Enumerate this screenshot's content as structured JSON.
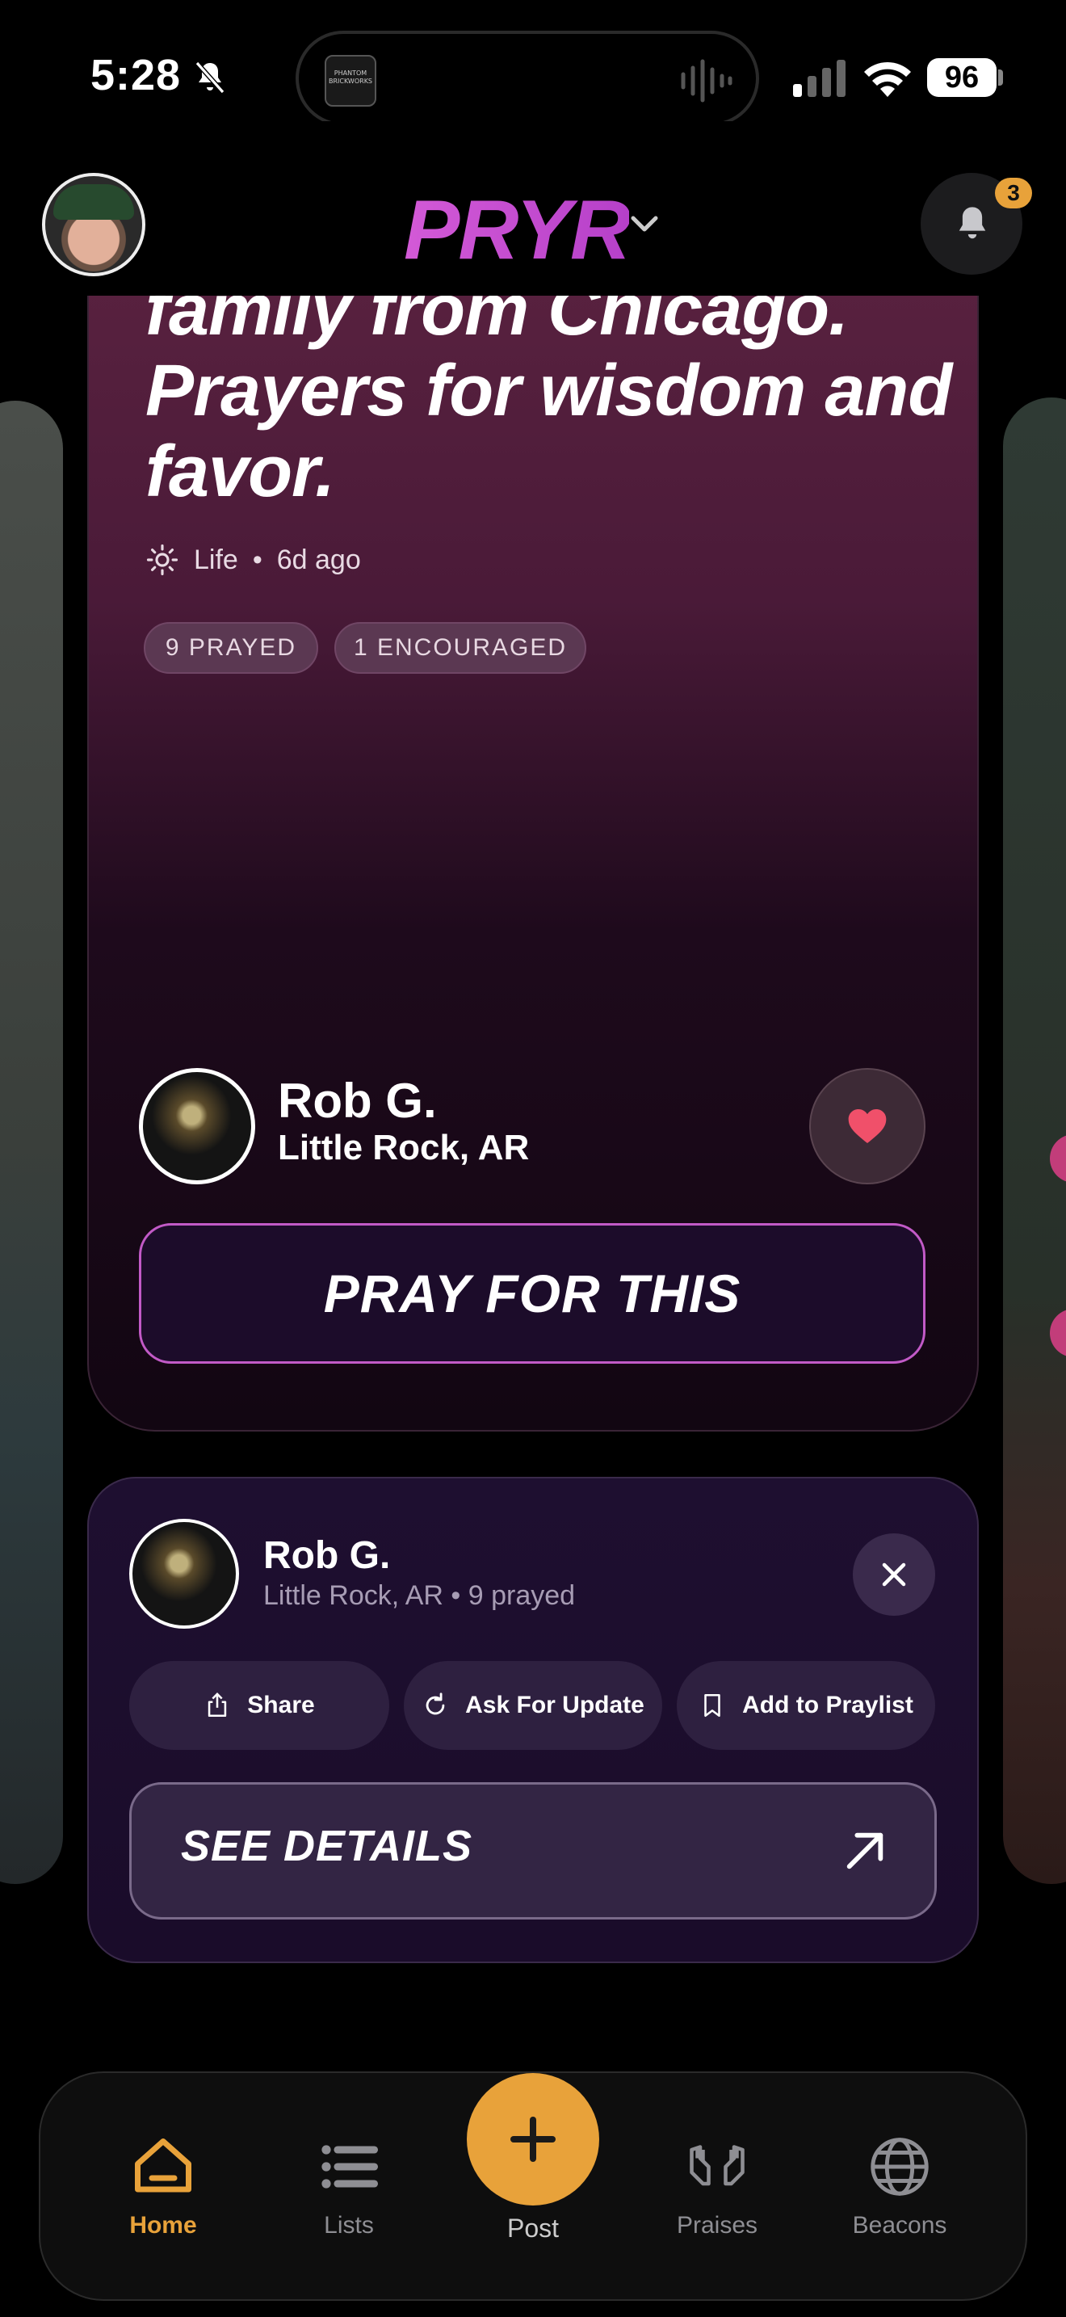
{
  "status_bar": {
    "time": "5:28",
    "battery": "96",
    "island_art_text": "PHANTOM BRICKWORKS"
  },
  "header": {
    "logo": "PRYR",
    "notifications_count": "3"
  },
  "card": {
    "headline": "family from Chicago. Prayers for wisdom and favor.",
    "category": "Life",
    "age": "6d ago",
    "separator": "•",
    "prayed_pill": "9 PRAYED",
    "encouraged_pill": "1 ENCOURAGED",
    "author_name": "Rob G.",
    "author_location": "Little Rock, AR",
    "pray_button": "PRAY FOR THIS"
  },
  "sheet": {
    "name": "Rob G.",
    "subline": "Little Rock, AR • 9 prayed",
    "actions": [
      {
        "label": "Share",
        "icon": "share-icon"
      },
      {
        "label": "Ask For Update",
        "icon": "refresh-icon"
      },
      {
        "label": "Add to Praylist",
        "icon": "bookmark-icon"
      }
    ],
    "details_button": "SEE DETAILS"
  },
  "tabbar": {
    "tabs": [
      {
        "label": "Home",
        "icon": "home-icon",
        "active": true
      },
      {
        "label": "Lists",
        "icon": "list-icon",
        "active": false
      },
      {
        "label": "Post",
        "icon": "plus-icon",
        "active": false
      },
      {
        "label": "Praises",
        "icon": "praise-hands-icon",
        "active": false
      },
      {
        "label": "Beacons",
        "icon": "globe-icon",
        "active": false
      }
    ]
  },
  "colors": {
    "accent": "#e8a23a",
    "brand": "#c94bd0",
    "heart": "#f0506a"
  }
}
